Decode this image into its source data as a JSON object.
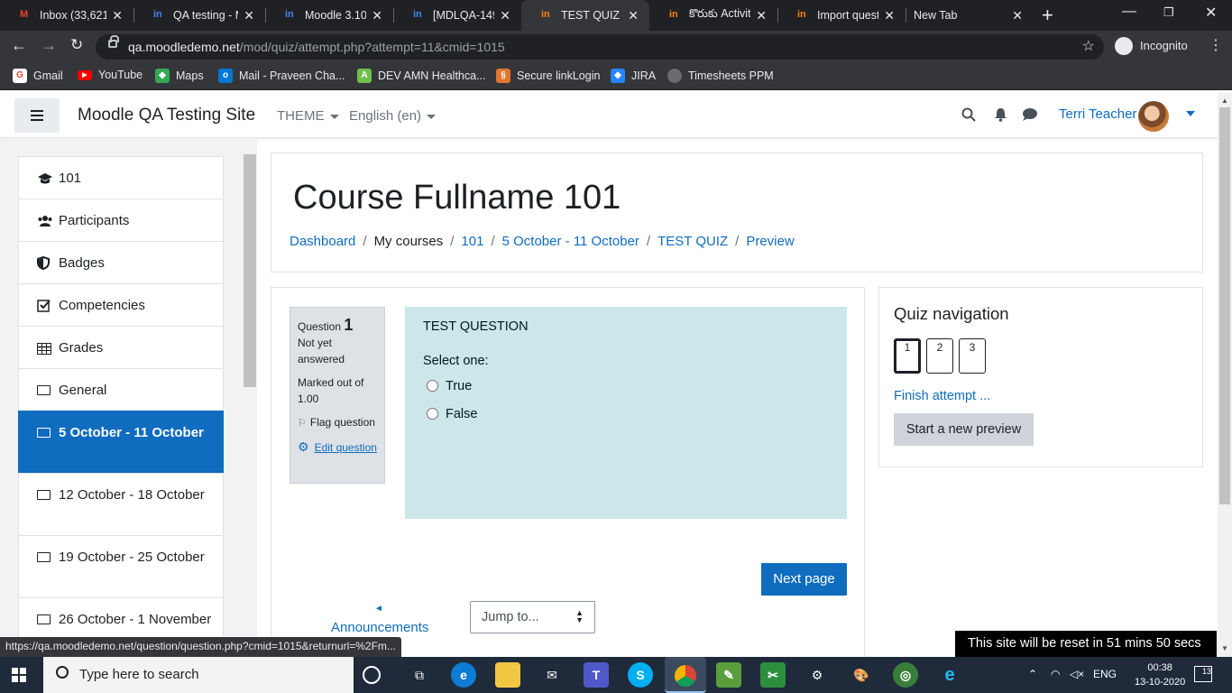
{
  "browser": {
    "tabs": [
      {
        "title": "Inbox (33,621)"
      },
      {
        "title": "QA testing - M"
      },
      {
        "title": "Moodle 3.10 C"
      },
      {
        "title": "[MDLQA-1492"
      },
      {
        "title": "TEST QUIZ (pa"
      },
      {
        "title": "కొరుకు Activity"
      },
      {
        "title": "Import questic"
      },
      {
        "title": "New Tab"
      }
    ],
    "url_host": "qa.moodledemo.net",
    "url_path": "/mod/quiz/attempt.php?attempt=11&cmid=1015",
    "incognito_label": "Incognito",
    "bookmarks": [
      {
        "label": "Gmail",
        "icon": "gmail-icon",
        "color": "#ea4335"
      },
      {
        "label": "YouTube",
        "icon": "youtube-icon",
        "color": "#ff0000"
      },
      {
        "label": "Maps",
        "icon": "maps-icon",
        "color": "#34a853"
      },
      {
        "label": "Mail - Praveen Cha...",
        "icon": "outlook-icon",
        "color": "#0078d4"
      },
      {
        "label": "DEV AMN Healthca...",
        "icon": "cloud-icon",
        "color": "#6fbf4a"
      },
      {
        "label": "Secure linkLogin",
        "icon": "link-icon",
        "color": "#e2752d"
      },
      {
        "label": "JIRA",
        "icon": "jira-icon",
        "color": "#2684ff"
      },
      {
        "label": "Timesheets PPM",
        "icon": "ppm-icon",
        "color": "#6b6b6b"
      }
    ]
  },
  "navbar": {
    "site_name": "Moodle QA Testing Site",
    "theme_label": "THEME",
    "language_label": "English (en)",
    "user_name": "Terri Teacher"
  },
  "drawer": {
    "items": [
      {
        "label": "101",
        "icon": "mortarboard-icon"
      },
      {
        "label": "Participants",
        "icon": "users-icon"
      },
      {
        "label": "Badges",
        "icon": "shield-icon"
      },
      {
        "label": "Competencies",
        "icon": "checkbox-icon"
      },
      {
        "label": "Grades",
        "icon": "table-icon"
      },
      {
        "label": "General",
        "icon": "folder-icon"
      },
      {
        "label": "5 October - 11 October",
        "icon": "folder-icon"
      },
      {
        "label": "12 October - 18 October",
        "icon": "folder-icon"
      },
      {
        "label": "19 October - 25 October",
        "icon": "folder-icon"
      },
      {
        "label": "26 October - 1 November",
        "icon": "folder-icon"
      }
    ]
  },
  "header": {
    "course_title": "Course Fullname 101",
    "breadcrumb": [
      "Dashboard",
      "My courses",
      "101",
      "5 October - 11 October",
      "TEST QUIZ",
      "Preview"
    ]
  },
  "question": {
    "label": "Question",
    "number": "1",
    "state": "Not yet answered",
    "marks": "Marked out of 1.00",
    "flag_label": "Flag question",
    "edit_label": "Edit question",
    "text": "TEST QUESTION",
    "prompt": "Select one:",
    "options": [
      "True",
      "False"
    ]
  },
  "actions": {
    "next_page": "Next page",
    "announcements": "Announcements",
    "jump_to": "Jump to..."
  },
  "quiz_nav": {
    "title": "Quiz navigation",
    "buttons": [
      "1",
      "2",
      "3"
    ],
    "finish": "Finish attempt ...",
    "new_preview": "Start a new preview"
  },
  "status": {
    "link_url": "https://qa.moodledemo.net/question/question.php?cmid=1015&returnurl=%2Fm...",
    "reset_notice": "This site will be reset in 51 mins 50 secs"
  },
  "taskbar": {
    "search_placeholder": "Type here to search",
    "language": "ENG",
    "time": "00:38",
    "date": "13-10-2020",
    "notifications": "13"
  }
}
